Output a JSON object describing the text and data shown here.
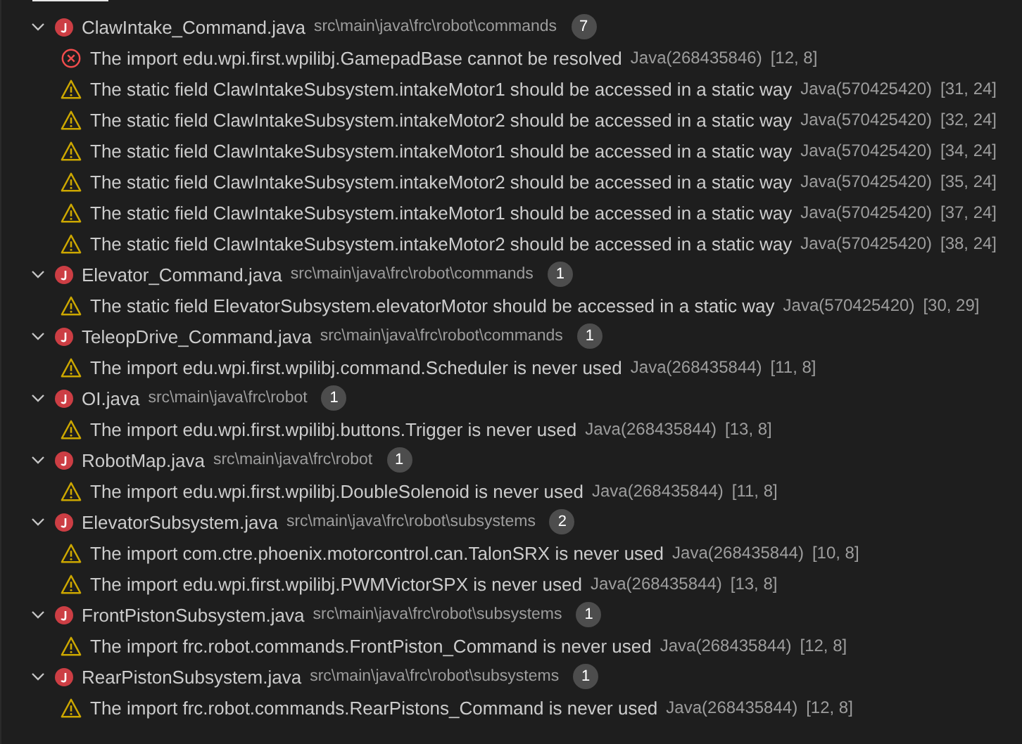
{
  "files": [
    {
      "name": "ClawIntake_Command.java",
      "path": "src\\main\\java\\frc\\robot\\commands",
      "count": "7",
      "expanded": true,
      "problems": [
        {
          "kind": "error",
          "message": "The import edu.wpi.first.wpilibj.GamepadBase cannot be resolved",
          "source": "Java(268435846)",
          "position": "[12, 8]"
        },
        {
          "kind": "warning",
          "message": "The static field ClawIntakeSubsystem.intakeMotor1 should be accessed in a static way",
          "source": "Java(570425420)",
          "position": "[31, 24]"
        },
        {
          "kind": "warning",
          "message": "The static field ClawIntakeSubsystem.intakeMotor2 should be accessed in a static way",
          "source": "Java(570425420)",
          "position": "[32, 24]"
        },
        {
          "kind": "warning",
          "message": "The static field ClawIntakeSubsystem.intakeMotor1 should be accessed in a static way",
          "source": "Java(570425420)",
          "position": "[34, 24]"
        },
        {
          "kind": "warning",
          "message": "The static field ClawIntakeSubsystem.intakeMotor2 should be accessed in a static way",
          "source": "Java(570425420)",
          "position": "[35, 24]"
        },
        {
          "kind": "warning",
          "message": "The static field ClawIntakeSubsystem.intakeMotor1 should be accessed in a static way",
          "source": "Java(570425420)",
          "position": "[37, 24]"
        },
        {
          "kind": "warning",
          "message": "The static field ClawIntakeSubsystem.intakeMotor2 should be accessed in a static way",
          "source": "Java(570425420)",
          "position": "[38, 24]"
        }
      ]
    },
    {
      "name": "Elevator_Command.java",
      "path": "src\\main\\java\\frc\\robot\\commands",
      "count": "1",
      "expanded": true,
      "problems": [
        {
          "kind": "warning",
          "message": "The static field ElevatorSubsystem.elevatorMotor should be accessed in a static way",
          "source": "Java(570425420)",
          "position": "[30, 29]"
        }
      ]
    },
    {
      "name": "TeleopDrive_Command.java",
      "path": "src\\main\\java\\frc\\robot\\commands",
      "count": "1",
      "expanded": true,
      "problems": [
        {
          "kind": "warning",
          "message": "The import edu.wpi.first.wpilibj.command.Scheduler is never used",
          "source": "Java(268435844)",
          "position": "[11, 8]"
        }
      ]
    },
    {
      "name": "OI.java",
      "path": "src\\main\\java\\frc\\robot",
      "count": "1",
      "expanded": true,
      "problems": [
        {
          "kind": "warning",
          "message": "The import edu.wpi.first.wpilibj.buttons.Trigger is never used",
          "source": "Java(268435844)",
          "position": "[13, 8]"
        }
      ]
    },
    {
      "name": "RobotMap.java",
      "path": "src\\main\\java\\frc\\robot",
      "count": "1",
      "expanded": true,
      "problems": [
        {
          "kind": "warning",
          "message": "The import edu.wpi.first.wpilibj.DoubleSolenoid is never used",
          "source": "Java(268435844)",
          "position": "[11, 8]"
        }
      ]
    },
    {
      "name": "ElevatorSubsystem.java",
      "path": "src\\main\\java\\frc\\robot\\subsystems",
      "count": "2",
      "expanded": true,
      "problems": [
        {
          "kind": "warning",
          "message": "The import com.ctre.phoenix.motorcontrol.can.TalonSRX is never used",
          "source": "Java(268435844)",
          "position": "[10, 8]"
        },
        {
          "kind": "warning",
          "message": "The import edu.wpi.first.wpilibj.PWMVictorSPX is never used",
          "source": "Java(268435844)",
          "position": "[13, 8]"
        }
      ]
    },
    {
      "name": "FrontPistonSubsystem.java",
      "path": "src\\main\\java\\frc\\robot\\subsystems",
      "count": "1",
      "expanded": true,
      "problems": [
        {
          "kind": "warning",
          "message": "The import frc.robot.commands.FrontPiston_Command is never used",
          "source": "Java(268435844)",
          "position": "[12, 8]"
        }
      ]
    },
    {
      "name": "RearPistonSubsystem.java",
      "path": "src\\main\\java\\frc\\robot\\subsystems",
      "count": "1",
      "expanded": true,
      "problems": [
        {
          "kind": "warning",
          "message": "The import frc.robot.commands.RearPistons_Command is never used",
          "source": "Java(268435844)",
          "position": "[12, 8]"
        }
      ]
    }
  ]
}
